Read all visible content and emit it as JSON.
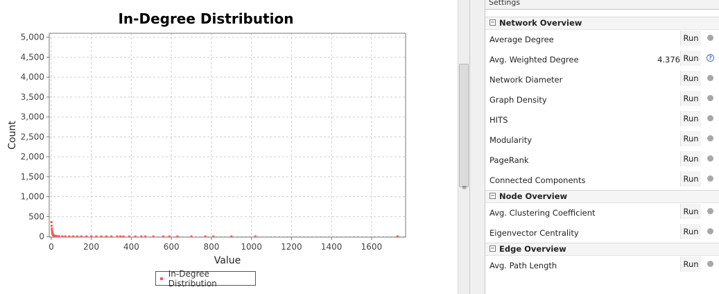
{
  "chart_data": {
    "type": "scatter",
    "title": "In-Degree Distribution",
    "xlabel": "Value",
    "ylabel": "Count",
    "xlim": [
      -10,
      1770
    ],
    "ylim": [
      -15,
      5100
    ],
    "x_ticks": [
      0,
      200,
      400,
      600,
      800,
      1000,
      1200,
      1400,
      1600
    ],
    "y_ticks": [
      0,
      500,
      1000,
      1500,
      2000,
      2500,
      3000,
      3500,
      4000,
      4500,
      5000
    ],
    "y_tick_labels": [
      "0",
      "500",
      "1,000",
      "1,500",
      "2,000",
      "2,500",
      "3,000",
      "3,500",
      "4,000",
      "4,500",
      "5,000"
    ],
    "grid": true,
    "legend_position": "bottom",
    "series": [
      {
        "name": "In-Degree Distribution",
        "color": "#ff5555",
        "x": [
          1,
          2,
          3,
          4,
          5,
          6,
          7,
          8,
          9,
          10,
          12,
          14,
          16,
          18,
          20,
          25,
          30,
          40,
          55,
          70,
          90,
          110,
          130,
          150,
          175,
          200,
          225,
          250,
          275,
          300,
          330,
          345,
          360,
          390,
          420,
          450,
          470,
          510,
          560,
          590,
          630,
          700,
          770,
          810,
          900,
          1020,
          1730
        ],
        "y": [
          360,
          270,
          200,
          150,
          110,
          90,
          70,
          55,
          45,
          35,
          28,
          22,
          18,
          15,
          12,
          9,
          7,
          5,
          4,
          3,
          3,
          2,
          2,
          2,
          1,
          1,
          1,
          1,
          1,
          1,
          1,
          1,
          1,
          1,
          1,
          1,
          1,
          1,
          1,
          1,
          1,
          1,
          1,
          1,
          1,
          1,
          1
        ]
      }
    ]
  },
  "legend": {
    "label": "In-Degree Distribution"
  },
  "settings": {
    "label": "Settings"
  },
  "sections": {
    "network": {
      "title": "Network Overview",
      "rows": [
        {
          "label": "Average Degree",
          "run": "Run"
        },
        {
          "label": "Avg. Weighted Degree",
          "value": "4.376",
          "run": "Run"
        },
        {
          "label": "Network Diameter",
          "run": "Run"
        },
        {
          "label": "Graph Density",
          "run": "Run"
        },
        {
          "label": "HITS",
          "run": "Run"
        },
        {
          "label": "Modularity",
          "run": "Run"
        },
        {
          "label": "PageRank",
          "run": "Run"
        },
        {
          "label": "Connected Components",
          "run": "Run"
        }
      ]
    },
    "node": {
      "title": "Node Overview",
      "rows": [
        {
          "label": "Avg. Clustering Coefficient",
          "run": "Run"
        },
        {
          "label": "Eigenvector Centrality",
          "run": "Run"
        }
      ]
    },
    "edge": {
      "title": "Edge Overview",
      "rows": [
        {
          "label": "Avg. Path Length",
          "run": "Run"
        }
      ]
    }
  },
  "icons": {
    "collapse": "collapse-minus-icon",
    "help": "help-question-icon",
    "status": "status-dot-icon",
    "grip": "scroll-grip-icon"
  },
  "colors": {
    "series": "#ff5555",
    "help": "#3a6fc4"
  }
}
